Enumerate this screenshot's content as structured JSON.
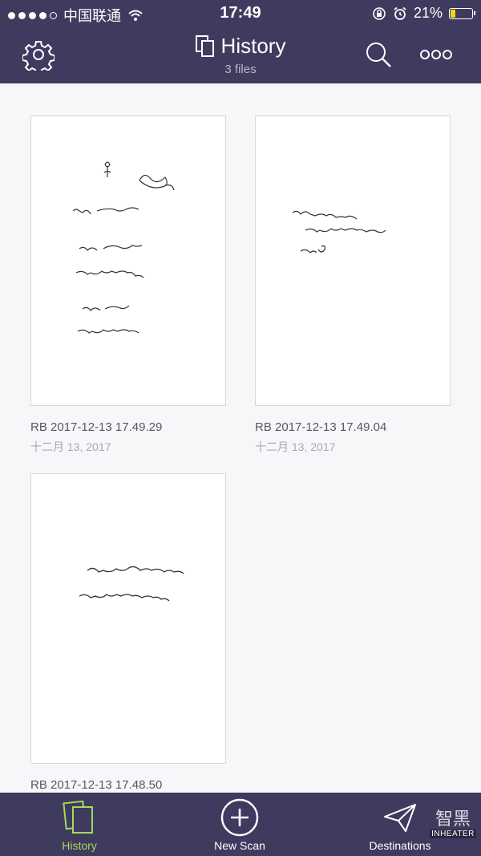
{
  "status_bar": {
    "carrier": "中国联通",
    "time": "17:49",
    "battery": "21%",
    "battery_level": 0.21
  },
  "header": {
    "title": "History",
    "subtitle": "3 files",
    "icons": [
      "gear-icon",
      "files-icon",
      "search-icon",
      "more-icon"
    ]
  },
  "files": [
    {
      "name": "RB 2017-12-13 17.49.29",
      "date": "十二月 13, 2017"
    },
    {
      "name": "RB 2017-12-13 17.49.04",
      "date": "十二月 13, 2017"
    },
    {
      "name": "RB 2017-12-13 17.48.50",
      "date": ""
    }
  ],
  "tabbar": {
    "history": "History",
    "new_scan": "New Scan",
    "destinations": "Destinations"
  },
  "watermark": {
    "logo_text": "智黑",
    "brand": "INHEATER"
  },
  "colors": {
    "header_bg": "#3f3b5f",
    "active_tab": "#a8d85a",
    "battery_fill": "#f7d21b"
  }
}
